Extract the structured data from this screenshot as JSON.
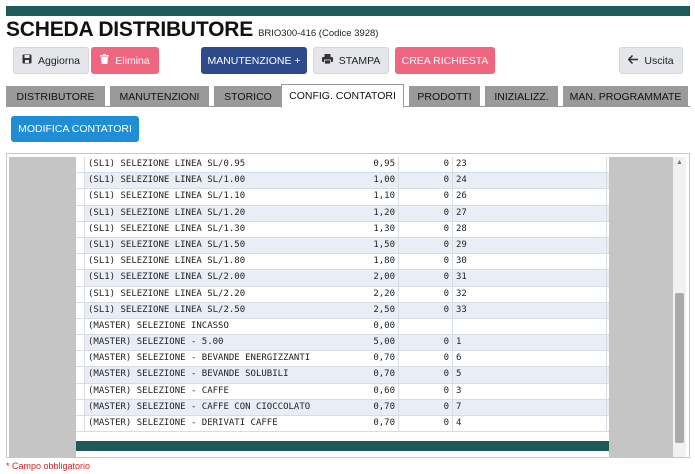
{
  "header": {
    "title": "SCHEDA DISTRIBUTORE",
    "subtitle": "BRIO300-416 (Codice 3928)"
  },
  "toolbar": {
    "aggiorna": "Aggiorna",
    "elimina": "Elimina",
    "manutenzione": "MANUTENZIONE +",
    "stampa": "STAMPA",
    "crea_richiesta": "CREA RICHIESTA",
    "uscita": "Uscita"
  },
  "tabs": [
    {
      "label": "DISTRIBUTORE"
    },
    {
      "label": "MANUTENZIONI"
    },
    {
      "label": "STORICO"
    },
    {
      "label": "CONFIG. CONTATORI",
      "active": true
    },
    {
      "label": "PRODOTTI"
    },
    {
      "label": "INIZIALIZZ."
    },
    {
      "label": "MAN. PROGRAMMATE"
    }
  ],
  "actions": {
    "modifica_contatori": "MODIFICA CONTATORI"
  },
  "rows": [
    {
      "name": "(SL1) SELEZIONE LINEA SL/0.95",
      "value": "0,95",
      "num": "0",
      "id": "23"
    },
    {
      "name": "(SL1) SELEZIONE LINEA SL/1.00",
      "value": "1,00",
      "num": "0",
      "id": "24"
    },
    {
      "name": "(SL1) SELEZIONE LINEA SL/1.10",
      "value": "1,10",
      "num": "0",
      "id": "26"
    },
    {
      "name": "(SL1) SELEZIONE LINEA SL/1.20",
      "value": "1,20",
      "num": "0",
      "id": "27"
    },
    {
      "name": "(SL1) SELEZIONE LINEA SL/1.30",
      "value": "1,30",
      "num": "0",
      "id": "28"
    },
    {
      "name": "(SL1) SELEZIONE LINEA SL/1.50",
      "value": "1,50",
      "num": "0",
      "id": "29"
    },
    {
      "name": "(SL1) SELEZIONE LINEA SL/1.80",
      "value": "1,80",
      "num": "0",
      "id": "30"
    },
    {
      "name": "(SL1) SELEZIONE LINEA SL/2.00",
      "value": "2,00",
      "num": "0",
      "id": "31"
    },
    {
      "name": "(SL1) SELEZIONE LINEA SL/2.20",
      "value": "2,20",
      "num": "0",
      "id": "32"
    },
    {
      "name": "(SL1) SELEZIONE LINEA SL/2.50",
      "value": "2,50",
      "num": "0",
      "id": "33"
    },
    {
      "name": "(MASTER) SELEZIONE INCASSO",
      "value": "0,00",
      "num": "",
      "id": ""
    },
    {
      "name": "(MASTER) SELEZIONE - 5.00",
      "value": "5,00",
      "num": "0",
      "id": "1"
    },
    {
      "name": "(MASTER) SELEZIONE - BEVANDE ENERGIZZANTI",
      "value": "0,70",
      "num": "0",
      "id": "6"
    },
    {
      "name": "(MASTER) SELEZIONE - BEVANDE SOLUBILI",
      "value": "0,70",
      "num": "0",
      "id": "5"
    },
    {
      "name": "(MASTER) SELEZIONE - CAFFE",
      "value": "0,60",
      "num": "0",
      "id": "3"
    },
    {
      "name": "(MASTER) SELEZIONE - CAFFE CON CIOCCOLATO",
      "value": "0,70",
      "num": "0",
      "id": "7"
    },
    {
      "name": "(MASTER) SELEZIONE - DERIVATI CAFFE",
      "value": "0,70",
      "num": "0",
      "id": "4"
    }
  ],
  "footnote": "* Campo obbligatorio",
  "icons": {
    "aggiorna": "save-icon",
    "elimina": "trash-icon",
    "stampa": "print-icon",
    "uscita": "arrow-left-icon"
  },
  "colors": {
    "header_bar": "#1e5a5a",
    "danger": "#f0657f",
    "primary": "#2d4a8a",
    "info": "#1f8ed6",
    "tab": "#9a9a9a"
  }
}
